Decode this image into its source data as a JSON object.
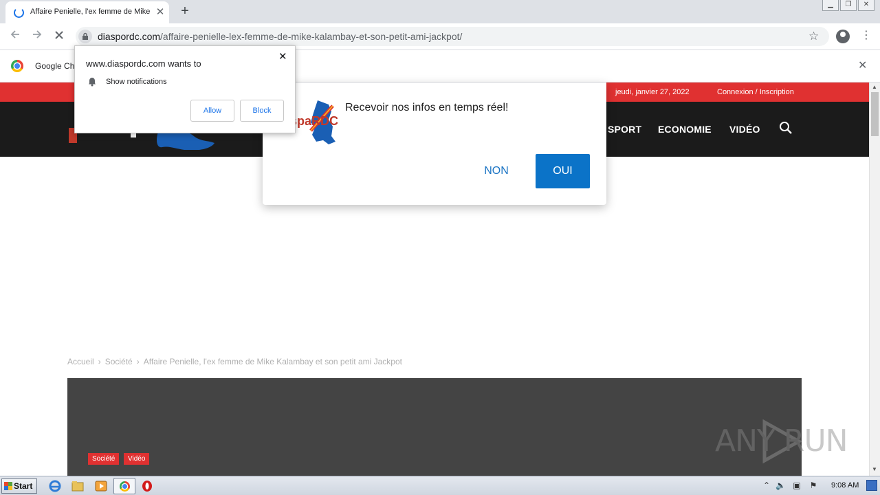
{
  "browser": {
    "tab_title": "Affaire Penielle, l'ex femme de Mike Kalambay et son petit ami Jackpot",
    "tab_close_glyph": "✕",
    "new_tab_glyph": "+",
    "url_host": "diaspordc.com",
    "url_path": "/affaire-penielle-lex-femme-de-mike-kalambay-et-son-petit-ami-jackpot/",
    "infobar_text": "Google Ch",
    "icons": {
      "back": "arrow-left-icon",
      "forward": "arrow-right-icon",
      "stop": "close-icon",
      "lock": "lock-icon",
      "bookmark": "star-icon",
      "profile": "account-circle-icon",
      "menu": "more-vert-icon"
    }
  },
  "permission_prompt": {
    "title": "www.diaspordc.com wants to",
    "permission": "Show notifications",
    "allow_label": "Allow",
    "block_label": "Block"
  },
  "site": {
    "topbar_date": "jeudi, janvier 27, 2022",
    "topbar_login": "Connexion / Inscription",
    "nav_items": [
      "SPORT",
      "ECONOMIE",
      "VIDÉO"
    ],
    "logo_text": "spaRDC",
    "breadcrumb": [
      "Accueil",
      "Société",
      "Affaire Penielle, l'ex femme de Mike Kalambay et son petit ami Jackpot"
    ],
    "tags": [
      "Société",
      "Vidéo"
    ],
    "colors": {
      "accent_red": "#e03131",
      "nav_bg": "#1b1b1b",
      "button_blue": "#0b73c8"
    }
  },
  "subscribe_popup": {
    "message": "Recevoir nos infos en temps réel!",
    "no_label": "NON",
    "yes_label": "OUI"
  },
  "watermark": {
    "text": "ANY RUN"
  },
  "taskbar": {
    "start_label": "Start",
    "clock": "9:08 AM"
  }
}
